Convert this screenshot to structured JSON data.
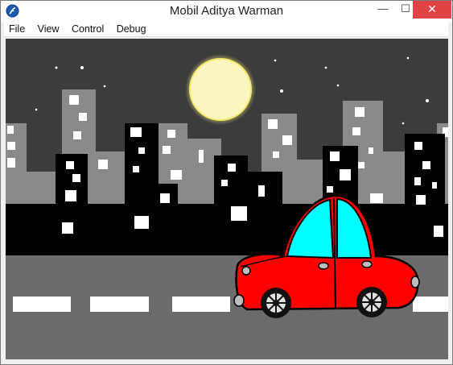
{
  "window": {
    "title": "Mobil Aditya Warman",
    "controls": {
      "minimize": "—",
      "maximize": "☐",
      "close": "✕"
    }
  },
  "menu": {
    "items": [
      "File",
      "View",
      "Control",
      "Debug"
    ]
  },
  "scene": {
    "sky_color": "#3c3c3c",
    "moon_color": "#fbf5c0",
    "moon_glow": "#f7ef82",
    "building_dark": "#000000",
    "building_gray": "#8a8a8a",
    "road_color": "#6b6b6b",
    "lane_color": "#ffffff",
    "car_body": "#ff0000",
    "car_window": "#00ffff"
  }
}
